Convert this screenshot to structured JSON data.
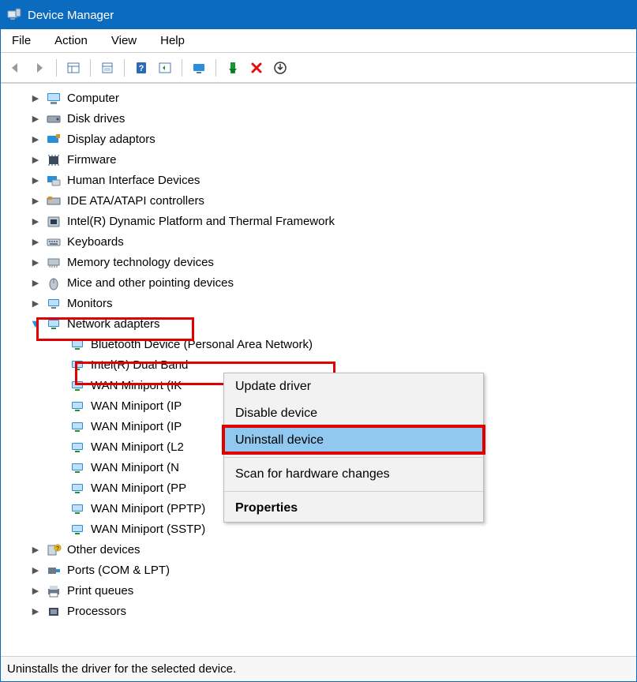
{
  "window": {
    "title": "Device Manager"
  },
  "menu": {
    "file": "File",
    "action": "Action",
    "view": "View",
    "help": "Help"
  },
  "tree": {
    "computer": "Computer",
    "disk_drives": "Disk drives",
    "display_adaptors": "Display adaptors",
    "firmware": "Firmware",
    "hid": "Human Interface Devices",
    "ide": "IDE ATA/ATAPI controllers",
    "intel_platform": "Intel(R) Dynamic Platform and Thermal Framework",
    "keyboards": "Keyboards",
    "memory_tech": "Memory technology devices",
    "mice": "Mice and other pointing devices",
    "monitors": "Monitors",
    "network_adapters": "Network adapters",
    "na_children": {
      "bt": "Bluetooth Device (Personal Area Network)",
      "intel_wifi": "Intel(R) Dual Band",
      "wan_ik": "WAN Miniport (IK",
      "wan_ip": "WAN Miniport (IP",
      "wan_ip2": "WAN Miniport (IP",
      "wan_l2": "WAN Miniport (L2",
      "wan_net": "WAN Miniport (N",
      "wan_pp": "WAN Miniport (PP",
      "wan_pptp": "WAN Miniport (PPTP)",
      "wan_sstp": "WAN Miniport (SSTP)"
    },
    "other_devices": "Other devices",
    "ports": "Ports (COM & LPT)",
    "print_queues": "Print queues",
    "processors": "Processors"
  },
  "context_menu": {
    "update": "Update driver",
    "disable": "Disable device",
    "uninstall": "Uninstall device",
    "scan": "Scan for hardware changes",
    "properties": "Properties"
  },
  "statusbar": {
    "text": "Uninstalls the driver for the selected device."
  }
}
